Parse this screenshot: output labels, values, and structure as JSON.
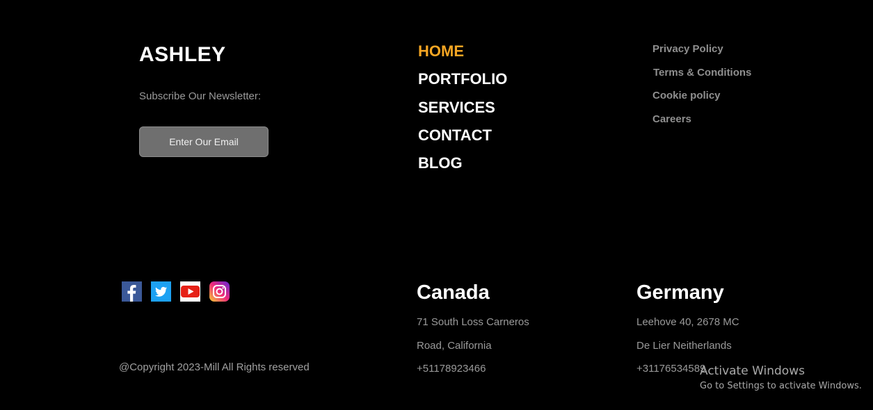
{
  "brand": {
    "name": "ASHLEY"
  },
  "newsletter": {
    "label": "Subscribe Our Newsletter:",
    "email_button": "Enter Our Email"
  },
  "nav": {
    "items": [
      {
        "label": "HOME",
        "active": true
      },
      {
        "label": "PORTFOLIO",
        "active": false
      },
      {
        "label": "SERVICES",
        "active": false
      },
      {
        "label": "CONTACT",
        "active": false
      },
      {
        "label": "BLOG",
        "active": false
      }
    ]
  },
  "legal": {
    "links": [
      {
        "label": "Privacy Policy"
      },
      {
        "label": "Terms & Conditions"
      },
      {
        "label": "Cookie policy"
      },
      {
        "label": "Careers"
      }
    ]
  },
  "social": {
    "icons": [
      "facebook-icon",
      "twitter-icon",
      "youtube-icon",
      "instagram-icon"
    ]
  },
  "footer": {
    "copyright": "@Copyright 2023-Mill All Rights reserved"
  },
  "offices": {
    "canada": {
      "country": "Canada",
      "line1": "71 South Loss Carneros",
      "line2": "Road, California",
      "phone": "+51178923466"
    },
    "germany": {
      "country": "Germany",
      "line1": "Leehove 40, 2678 MC",
      "line2": "De Lier Neitherlands",
      "phone": "+31176534589"
    }
  },
  "windows_watermark": {
    "title": "Activate Windows",
    "subtitle": "Go to Settings to activate Windows."
  },
  "colors": {
    "background": "#000000",
    "accent": "#f5a623",
    "muted_text": "#9a9a9a",
    "button_bg": "#6f6f6f"
  }
}
